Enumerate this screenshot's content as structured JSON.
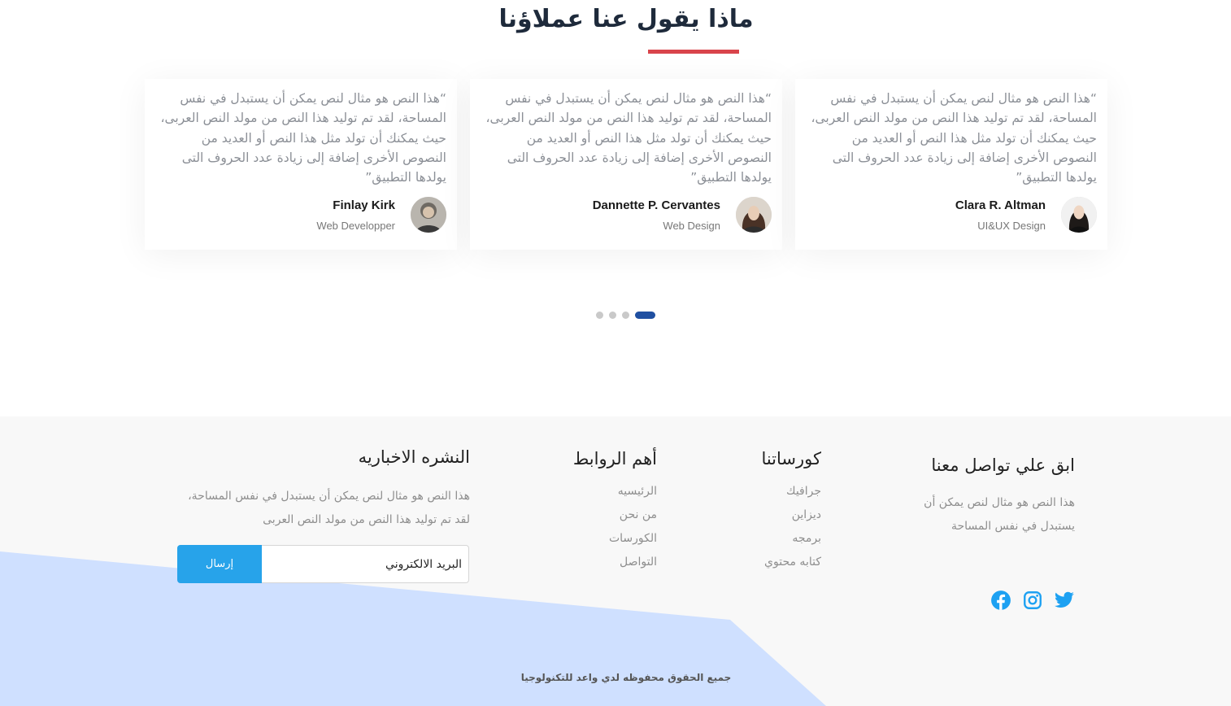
{
  "testimonials": {
    "title": "ماذا يقول عنا عملاؤنا",
    "cards": [
      {
        "quote": "“هذا النص هو مثال لنص يمكن أن يستبدل في نفس المساحة، لقد تم توليد هذا النص من مولد النص العربى، حيث يمكنك أن تولد مثل هذا النص أو العديد من النصوص الأخرى إضافة إلى زيادة عدد الحروف التى يولدها التطبيق”",
        "name": "Finlay Kirk",
        "role": "Web Developper",
        "avatar": "man-avatar"
      },
      {
        "quote": "“هذا النص هو مثال لنص يمكن أن يستبدل في نفس المساحة، لقد تم توليد هذا النص من مولد النص العربى، حيث يمكنك أن تولد مثل هذا النص أو العديد من النصوص الأخرى إضافة إلى زيادة عدد الحروف التى يولدها التطبيق”",
        "name": "Dannette P. Cervantes",
        "role": "Web Design",
        "avatar": "woman-avatar"
      },
      {
        "quote": "“هذا النص هو مثال لنص يمكن أن يستبدل في نفس المساحة، لقد تم توليد هذا النص من مولد النص العربى، حيث يمكنك أن تولد مثل هذا النص أو العديد من النصوص الأخرى إضافة إلى زيادة عدد الحروف التى يولدها التطبيق”",
        "name": "Clara R. Altman",
        "role": "UI&UX Design",
        "avatar": "woman-avatar"
      }
    ],
    "pagination": {
      "count": 4,
      "active_index": 3
    }
  },
  "footer": {
    "contact": {
      "heading": "ابق علي تواصل معنا",
      "text": "هذا النص هو مثال لنص يمكن أن يستبدل في نفس المساحة",
      "socials": [
        "twitter-icon",
        "instagram-icon",
        "facebook-icon"
      ]
    },
    "courses": {
      "heading": "كورساتنا",
      "items": [
        "جرافيك",
        "ديزاين",
        "برمجه",
        "كتابه محتوي"
      ]
    },
    "links": {
      "heading": "أهم الروابط",
      "items": [
        "الرئيسيه",
        "من نحن",
        "الكورسات",
        "التواصل"
      ]
    },
    "newsletter": {
      "heading": "النشره الاخباريه",
      "text": "هذا النص هو مثال لنص يمكن أن يستبدل في نفس المساحة، لقد تم توليد هذا النص من مولد النص العربى",
      "input_placeholder": "البريد الالكتروني",
      "button_label": "إرسال"
    },
    "copyright": "جميع الحقوق محفوظه لدي واعد للتكنولوجيا"
  },
  "colors": {
    "title": "#1e2a3b",
    "accent_red": "#d9444b",
    "dot_active": "#1f4fa1",
    "dot_inactive": "#c9c9c9",
    "social_blue": "#1da1f2",
    "button_blue": "#27a3ea",
    "footer_bg": "#f8f8f8",
    "footer_shape": "#cfe0ff"
  }
}
